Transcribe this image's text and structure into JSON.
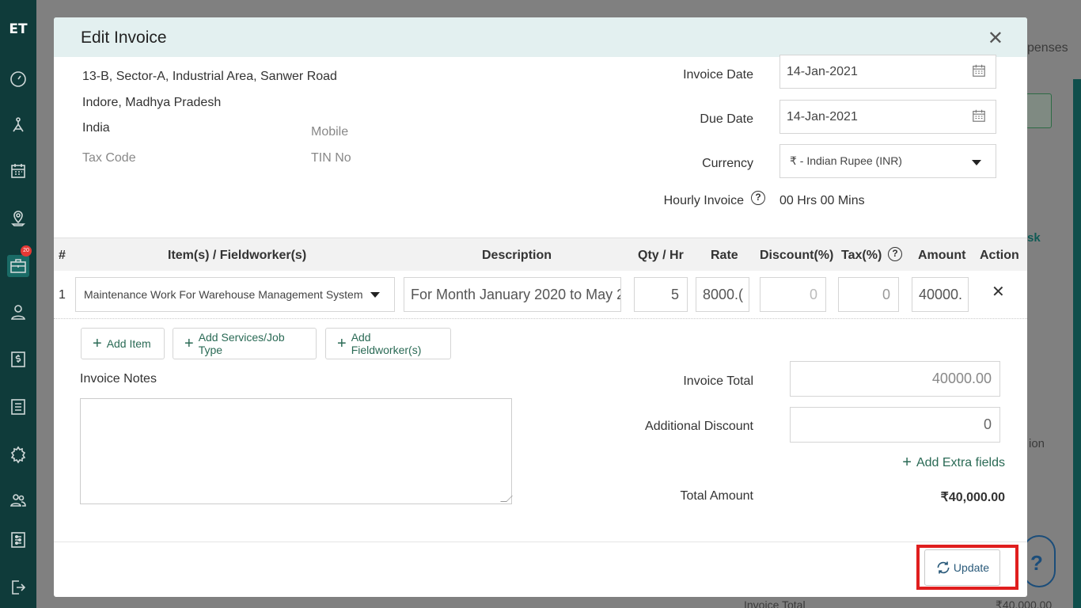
{
  "app": {
    "logo": "ET"
  },
  "sidebar": {
    "icons": [
      "dashboard-icon",
      "hierarchy-icon",
      "calendar-icon",
      "map-pin-icon",
      "briefcase-icon",
      "user-icon",
      "dollar-icon",
      "list-icon",
      "badge-icon",
      "users-icon",
      "settings-icon",
      "logout-icon"
    ],
    "badge": "20"
  },
  "background": {
    "tab_fragment": "penses",
    "column_fragment": "ion",
    "task_fragment": "sk",
    "bottom_label": "Invoice Total",
    "bottom_value": "₹40,000.00"
  },
  "modal": {
    "title": "Edit Invoice",
    "address": {
      "line1": "13-B, Sector-A, Industrial Area, Sanwer Road",
      "line2": "Indore, Madhya Pradesh",
      "country": "India",
      "tax_code_label": "Tax Code",
      "mobile_label": "Mobile",
      "tin_label": "TIN No"
    },
    "invoice_date": {
      "label": "Invoice Date",
      "value": "14-Jan-2021"
    },
    "due_date": {
      "label": "Due Date",
      "value": "14-Jan-2021"
    },
    "currency": {
      "label": "Currency",
      "value": "₹ - Indian Rupee (INR)"
    },
    "hourly": {
      "label": "Hourly Invoice",
      "value": "00 Hrs 00 Mins"
    },
    "table": {
      "headers": [
        "#",
        "Item(s) / Fieldworker(s)",
        "Description",
        "Qty / Hr",
        "Rate",
        "Discount(%)",
        "Tax(%)",
        "Amount",
        "Action"
      ],
      "rows": [
        {
          "num": "1",
          "item": "Maintenance Work For Warehouse Management System",
          "description": "For Month January 2020 to May 2",
          "qty": "5",
          "rate": "8000.(",
          "discount": "0",
          "tax": "0",
          "amount": "40000."
        }
      ]
    },
    "buttons": {
      "add_item": "Add Item",
      "add_services": "Add Services/Job Type",
      "add_fieldworker": "Add Fieldworker(s)",
      "add_extra": "Add Extra fields",
      "update": "Update"
    },
    "notes_label": "Invoice Notes",
    "invoice_total": {
      "label": "Invoice Total",
      "value": "40000.00"
    },
    "additional_discount": {
      "label": "Additional Discount",
      "value": "0"
    },
    "total_amount": {
      "label": "Total Amount",
      "value": "₹40,000.00"
    }
  }
}
